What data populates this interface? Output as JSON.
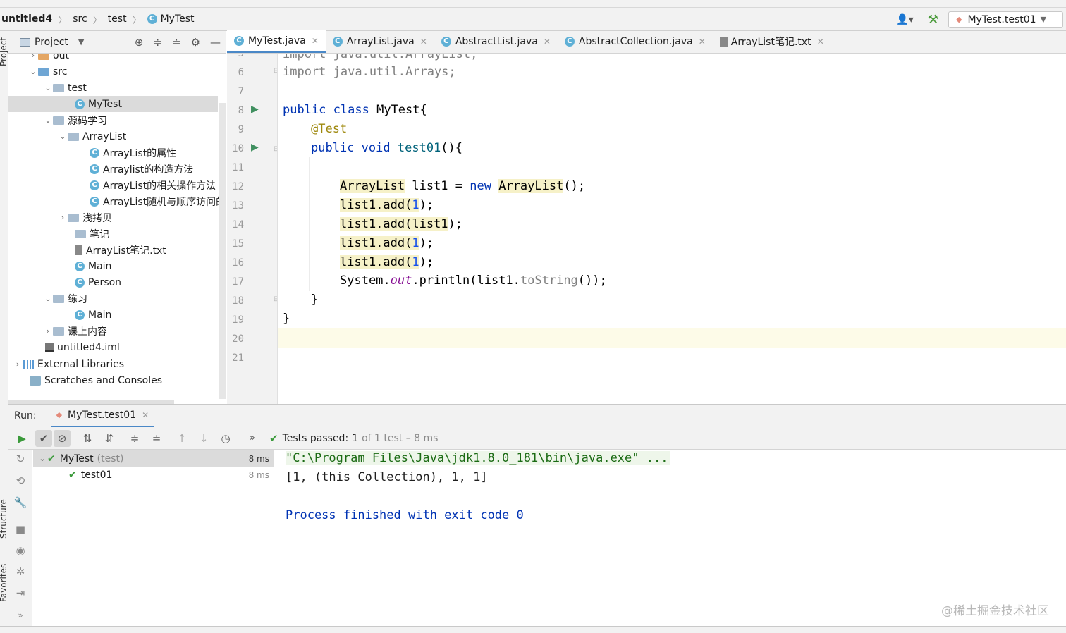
{
  "breadcrumb": {
    "project": "untitled4",
    "folder1": "src",
    "folder2": "test",
    "file": "MyTest"
  },
  "run_config": {
    "name": "MyTest.test01"
  },
  "side_labels": {
    "project": "Project",
    "structure": "Structure",
    "favorites": "Favorites"
  },
  "project_panel": {
    "title": "Project"
  },
  "tree": [
    {
      "label": "out",
      "type": "folder-out"
    },
    {
      "label": "src",
      "type": "folder-src"
    },
    {
      "label": "test",
      "type": "folder"
    },
    {
      "label": "MyTest",
      "type": "class"
    },
    {
      "label": "源码学习",
      "type": "folder"
    },
    {
      "label": "ArrayList",
      "type": "folder"
    },
    {
      "label": "ArrayList的属性",
      "type": "class"
    },
    {
      "label": "Arraylist的构造方法",
      "type": "class"
    },
    {
      "label": "ArrayList的相关操作方法",
      "type": "class"
    },
    {
      "label": "ArrayList随机与顺序访问的",
      "type": "class"
    },
    {
      "label": "浅拷贝",
      "type": "folder"
    },
    {
      "label": "笔记",
      "type": "folder"
    },
    {
      "label": "ArrayList笔记.txt",
      "type": "txt"
    },
    {
      "label": "Main",
      "type": "class"
    },
    {
      "label": "Person",
      "type": "class"
    },
    {
      "label": "练习",
      "type": "folder"
    },
    {
      "label": "Main",
      "type": "class"
    },
    {
      "label": "课上内容",
      "type": "folder"
    },
    {
      "label": "untitled4.iml",
      "type": "iml"
    },
    {
      "label": "External Libraries",
      "type": "lib"
    },
    {
      "label": "Scratches and Consoles",
      "type": "scratch"
    }
  ],
  "tabs": [
    {
      "label": "MyTest.java",
      "active": true
    },
    {
      "label": "ArrayList.java",
      "active": false
    },
    {
      "label": "AbstractList.java",
      "active": false
    },
    {
      "label": "AbstractCollection.java",
      "active": false
    },
    {
      "label": "ArrayList笔记.txt",
      "active": false
    }
  ],
  "editor": {
    "line_numbers": [
      "5",
      "6",
      "7",
      "8",
      "9",
      "10",
      "11",
      "12",
      "13",
      "14",
      "15",
      "16",
      "17",
      "18",
      "19",
      "20",
      "21"
    ],
    "code": {
      "l5": "import java.util.ArrayList;",
      "l6": "import java.util.Arrays;",
      "l8_kw1": "public",
      "l8_kw2": "class",
      "l8_rest": " MyTest{",
      "l9": "@Test",
      "l10_kw1": "public",
      "l10_kw2": "void",
      "l10_name": "test01",
      "l10_rest": "(){",
      "l12_type": "ArrayList",
      "l12_mid": " list1 = ",
      "l12_new": "new",
      "l12_type2": "ArrayList",
      "l12_end": "();",
      "l13_a": "list1.add(",
      "l13_n": "1",
      "l13_b": ");",
      "l14_a": "list1.add(",
      "l14_n": "list1",
      "l14_b": ");",
      "l15_a": "list1.add(",
      "l15_n": "1",
      "l15_b": ");",
      "l16_a": "list1.add(",
      "l16_n": "1",
      "l16_b": ");",
      "l17_a": "System.",
      "l17_out": "out",
      "l17_b": ".println(list1.",
      "l17_m": "toString",
      "l17_c": "());",
      "l18": "}",
      "l19": "}"
    }
  },
  "run_panel": {
    "label": "Run:",
    "tab": "MyTest.test01",
    "status": {
      "passed_label": "Tests passed:",
      "count": "1",
      "of_text": "of 1 test – 8 ms"
    },
    "tests": [
      {
        "name": "MyTest",
        "suffix": "(test)",
        "time": "8 ms"
      },
      {
        "name": "test01",
        "suffix": "",
        "time": "8 ms"
      }
    ],
    "console": [
      "\"C:\\Program Files\\Java\\jdk1.8.0_181\\bin\\java.exe\" ...",
      "[1, (this Collection), 1, 1]",
      "",
      "Process finished with exit code 0"
    ]
  },
  "watermark": "@稀土掘金技术社区"
}
